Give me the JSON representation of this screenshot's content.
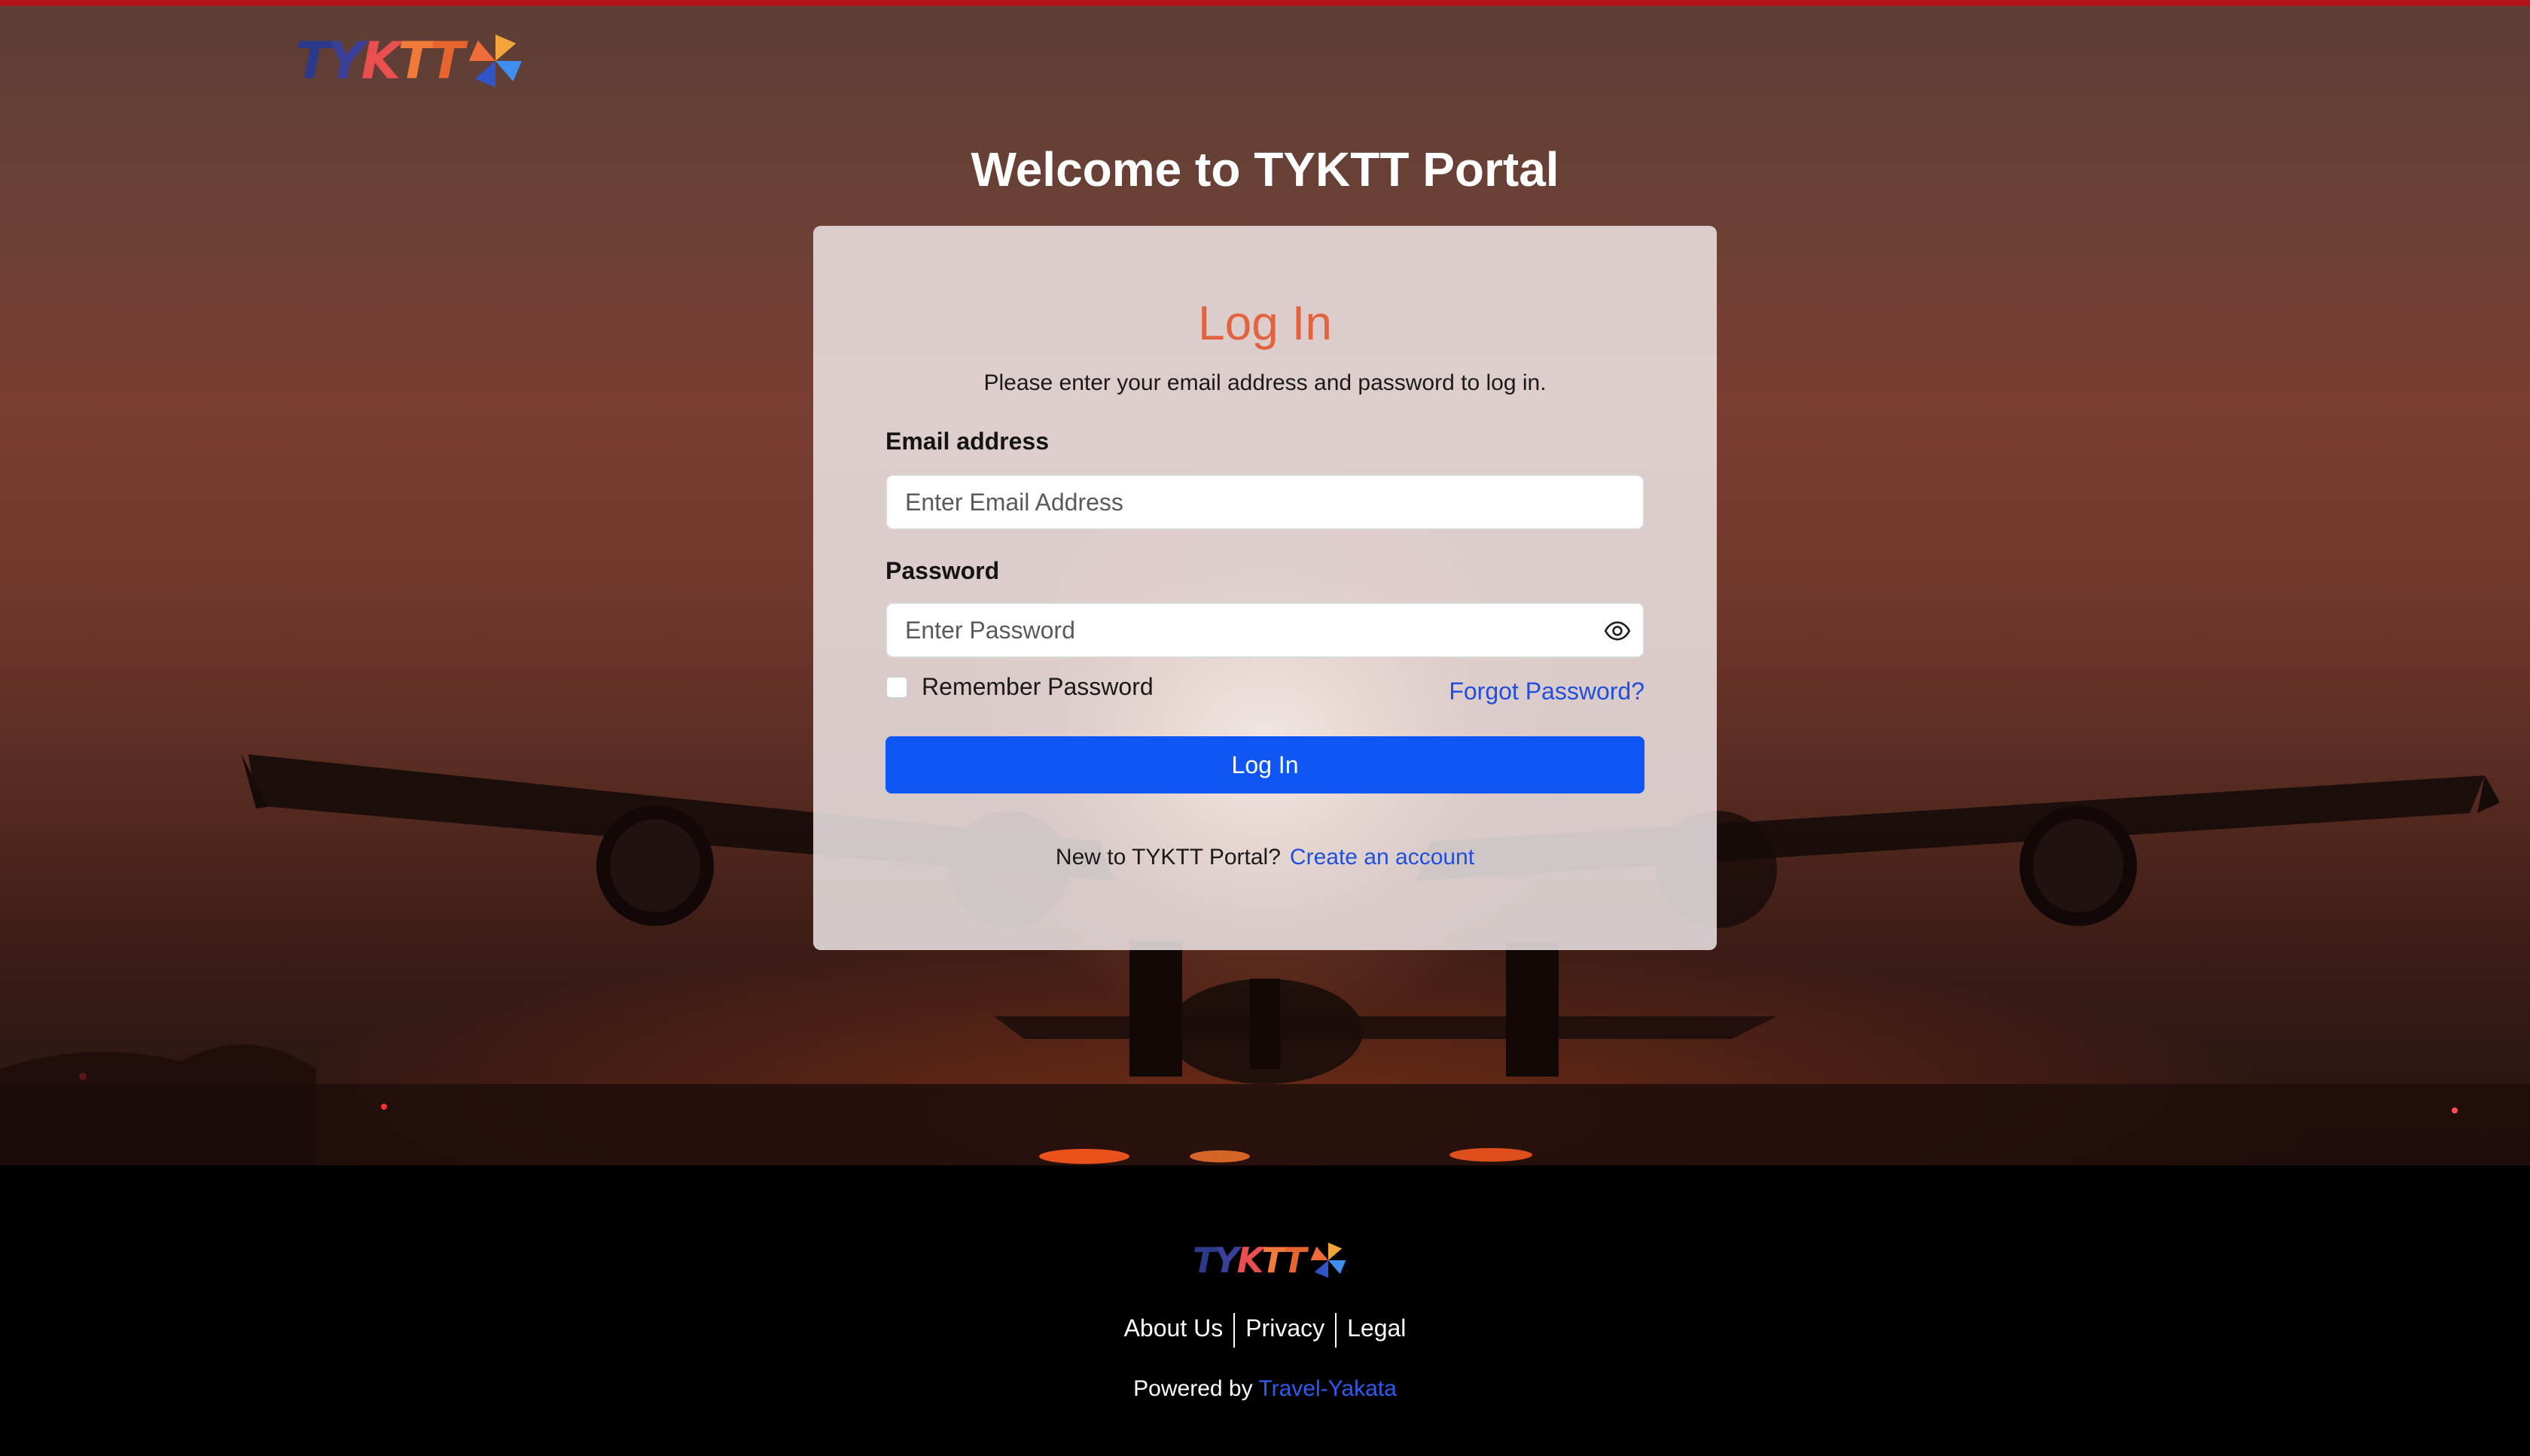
{
  "header": {
    "logo_text": [
      "T",
      "Y",
      "K",
      "T",
      "T"
    ],
    "welcome_title": "Welcome to TYKTT Portal"
  },
  "login_card": {
    "title": "Log In",
    "subtitle": "Please enter your email address and password to log in.",
    "email_label": "Email address",
    "email_placeholder": "Enter Email Address",
    "email_value": "",
    "password_label": "Password",
    "password_placeholder": "Enter Password",
    "password_value": "",
    "remember_label": "Remember Password",
    "remember_checked": false,
    "forgot_label": "Forgot Password?",
    "login_button": "Log In",
    "new_prompt": "New to TYKTT Portal?",
    "create_account": "Create an account"
  },
  "footer": {
    "links": [
      "About Us",
      "Privacy",
      "Legal"
    ],
    "powered_prefix": "Powered by",
    "powered_link": "Travel-Yakata"
  },
  "colors": {
    "title_accent": "#e2643f",
    "primary_button": "#0f56f4",
    "link": "#1f4fe0",
    "top_bar": "#b0141a"
  },
  "icons": {
    "password_toggle": "eye-icon",
    "logo_mark": "pinwheel-logo-mark"
  }
}
